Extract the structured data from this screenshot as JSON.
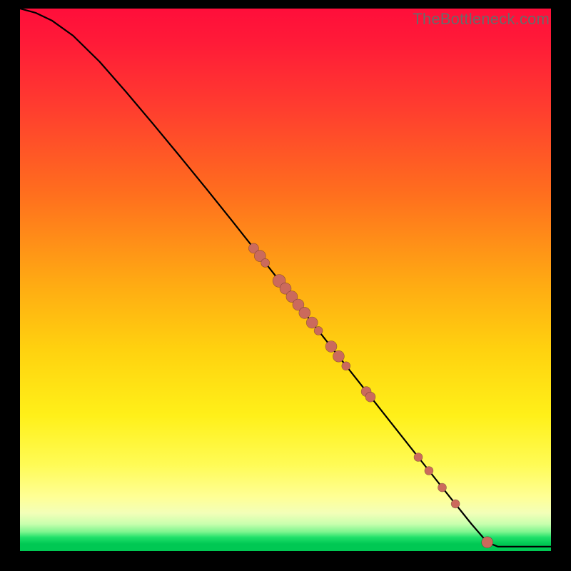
{
  "watermark": "TheBottleneck.com",
  "colors": {
    "curve": "#000000",
    "point_fill": "#cb6a5c",
    "gradient_top": "#ff0e3a",
    "gradient_bottom": "#00c853",
    "background": "#000000"
  },
  "chart_data": {
    "type": "line",
    "title": "",
    "xlabel": "",
    "ylabel": "",
    "xlim": [
      0,
      100
    ],
    "ylim": [
      0,
      100
    ],
    "grid": false,
    "legend": false,
    "curve": [
      {
        "x": 0,
        "y": 100
      },
      {
        "x": 3,
        "y": 99.2
      },
      {
        "x": 6,
        "y": 97.8
      },
      {
        "x": 10,
        "y": 95.0
      },
      {
        "x": 15,
        "y": 90.2
      },
      {
        "x": 20,
        "y": 84.6
      },
      {
        "x": 25,
        "y": 78.8
      },
      {
        "x": 30,
        "y": 72.9
      },
      {
        "x": 35,
        "y": 66.9
      },
      {
        "x": 40,
        "y": 60.8
      },
      {
        "x": 45,
        "y": 54.6
      },
      {
        "x": 50,
        "y": 48.4
      },
      {
        "x": 55,
        "y": 42.1
      },
      {
        "x": 60,
        "y": 35.9
      },
      {
        "x": 65,
        "y": 29.7
      },
      {
        "x": 70,
        "y": 23.5
      },
      {
        "x": 75,
        "y": 17.3
      },
      {
        "x": 80,
        "y": 11.1
      },
      {
        "x": 85,
        "y": 5.0
      },
      {
        "x": 88,
        "y": 1.6
      },
      {
        "x": 90,
        "y": 0.8
      },
      {
        "x": 95,
        "y": 0.8
      },
      {
        "x": 100,
        "y": 0.8
      }
    ],
    "series": [
      {
        "name": "points",
        "marker": "circle",
        "color": "#cb6a5c",
        "values": [
          {
            "x": 44.0,
            "y": 55.8,
            "r": 7
          },
          {
            "x": 45.2,
            "y": 54.4,
            "r": 8
          },
          {
            "x": 46.2,
            "y": 53.1,
            "r": 6
          },
          {
            "x": 48.8,
            "y": 49.8,
            "r": 9
          },
          {
            "x": 50.0,
            "y": 48.4,
            "r": 8
          },
          {
            "x": 51.2,
            "y": 46.9,
            "r": 8
          },
          {
            "x": 52.4,
            "y": 45.4,
            "r": 8
          },
          {
            "x": 53.6,
            "y": 43.9,
            "r": 8
          },
          {
            "x": 55.0,
            "y": 42.1,
            "r": 8
          },
          {
            "x": 56.2,
            "y": 40.6,
            "r": 6
          },
          {
            "x": 58.6,
            "y": 37.7,
            "r": 8
          },
          {
            "x": 60.0,
            "y": 35.9,
            "r": 8
          },
          {
            "x": 61.4,
            "y": 34.1,
            "r": 6
          },
          {
            "x": 65.2,
            "y": 29.4,
            "r": 7
          },
          {
            "x": 66.0,
            "y": 28.4,
            "r": 7
          },
          {
            "x": 75.0,
            "y": 17.3,
            "r": 6
          },
          {
            "x": 77.0,
            "y": 14.8,
            "r": 6
          },
          {
            "x": 79.5,
            "y": 11.7,
            "r": 6
          },
          {
            "x": 82.0,
            "y": 8.7,
            "r": 6
          },
          {
            "x": 88.0,
            "y": 1.6,
            "r": 8
          }
        ]
      }
    ]
  }
}
